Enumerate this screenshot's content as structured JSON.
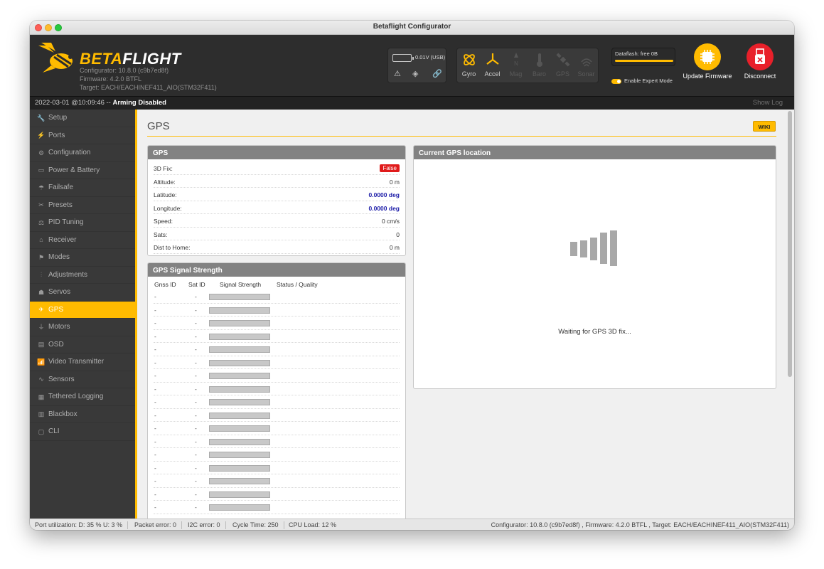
{
  "window": {
    "title": "Betaflight Configurator"
  },
  "header": {
    "logo_part1": "BETA",
    "logo_part2": "FLIGHT",
    "configurator_version": "Configurator: 10.8.0 (c9b7ed8f)",
    "firmware_version": "Firmware: 4.2.0 BTFL",
    "target": "Target: EACH/EACHINEF411_AIO(STM32F411)",
    "battery_text": "0.01V (USB)",
    "sensors": [
      {
        "label": "Gyro",
        "active": true
      },
      {
        "label": "Accel",
        "active": true
      },
      {
        "label": "Mag",
        "active": false
      },
      {
        "label": "Baro",
        "active": false
      },
      {
        "label": "GPS",
        "active": false
      },
      {
        "label": "Sonar",
        "active": false
      }
    ],
    "dataflash_text": "Dataflash: free 0B",
    "expert_mode_label": "Enable Expert Mode",
    "expert_mode_enabled": true,
    "update_firmware_label": "Update Firmware",
    "disconnect_label": "Disconnect",
    "accent_color": "#ffbb00",
    "disconnect_color": "#e8202a"
  },
  "status": {
    "datetime": "2022-03-01 @10:09:46 --",
    "arming": "Arming Disabled",
    "show_log": "Show Log"
  },
  "sidebar": {
    "items": [
      {
        "label": "Setup",
        "icon": "wrench-icon",
        "active": false
      },
      {
        "label": "Ports",
        "icon": "plug-icon",
        "active": false
      },
      {
        "label": "Configuration",
        "icon": "gear-icon",
        "active": false
      },
      {
        "label": "Power & Battery",
        "icon": "battery-icon",
        "active": false
      },
      {
        "label": "Failsafe",
        "icon": "parachute-icon",
        "active": false
      },
      {
        "label": "Presets",
        "icon": "presets-icon",
        "active": false
      },
      {
        "label": "PID Tuning",
        "icon": "pid-icon",
        "active": false
      },
      {
        "label": "Receiver",
        "icon": "receiver-icon",
        "active": false
      },
      {
        "label": "Modes",
        "icon": "modes-icon",
        "active": false
      },
      {
        "label": "Adjustments",
        "icon": "sliders-icon",
        "active": false
      },
      {
        "label": "Servos",
        "icon": "servo-icon",
        "active": false
      },
      {
        "label": "GPS",
        "icon": "satellite-icon",
        "active": true
      },
      {
        "label": "Motors",
        "icon": "motor-icon",
        "active": false
      },
      {
        "label": "OSD",
        "icon": "osd-icon",
        "active": false
      },
      {
        "label": "Video Transmitter",
        "icon": "antenna-icon",
        "active": false
      },
      {
        "label": "Sensors",
        "icon": "pulse-icon",
        "active": false
      },
      {
        "label": "Tethered Logging",
        "icon": "log-icon",
        "active": false
      },
      {
        "label": "Blackbox",
        "icon": "blackbox-icon",
        "active": false
      },
      {
        "label": "CLI",
        "icon": "terminal-icon",
        "active": false
      }
    ]
  },
  "page": {
    "title": "GPS",
    "wiki_label": "WIKI"
  },
  "gps_box": {
    "title": "GPS",
    "rows": [
      {
        "label": "3D Fix:",
        "value": "False",
        "style": "badge"
      },
      {
        "label": "Altitude:",
        "value": "0 m",
        "style": "plain"
      },
      {
        "label": "Latitude:",
        "value": "0.0000 deg",
        "style": "blue"
      },
      {
        "label": "Longitude:",
        "value": "0.0000 deg",
        "style": "blue"
      },
      {
        "label": "Speed:",
        "value": "0 cm/s",
        "style": "plain"
      },
      {
        "label": "Sats:",
        "value": "0",
        "style": "plain"
      },
      {
        "label": "Dist to Home:",
        "value": "0 m",
        "style": "plain"
      }
    ]
  },
  "signal_box": {
    "title": "GPS Signal Strength",
    "columns": [
      "Gnss ID",
      "Sat ID",
      "Signal Strength",
      "Status / Quality"
    ],
    "row_count": 17,
    "placeholder": "-"
  },
  "location_box": {
    "title": "Current GPS location",
    "waiting_text": "Waiting for GPS 3D fix..."
  },
  "bottom": {
    "port_utilization": "Port utilization: D: 35 % U: 3 %",
    "packet_error": "Packet error: 0",
    "i2c_error": "I2C error: 0",
    "cycle_time": "Cycle Time: 250",
    "cpu_load": "CPU Load: 12 %",
    "version_info": "Configurator: 10.8.0 (c9b7ed8f) , Firmware: 4.2.0 BTFL , Target: EACH/EACHINEF411_AIO(STM32F411)"
  }
}
